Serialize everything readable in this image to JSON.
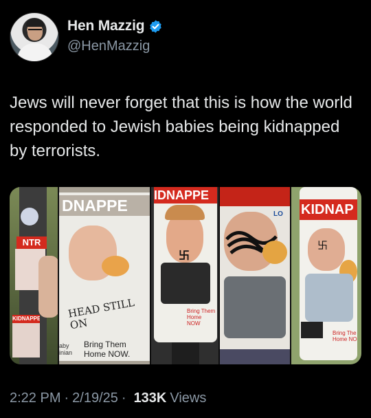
{
  "author": {
    "name": "Hen Mazzig",
    "handle": "@HenMazzig",
    "verified_icon": "verified-badge-icon",
    "accent": "#1d9bf0"
  },
  "tweet": {
    "text": "Jews will never forget that this is how the world responded to Jewish babies being kidnapped by terrorists."
  },
  "media": {
    "panels": [
      {
        "caption_a": "NTR",
        "caption_b": "KIDNAPPE"
      },
      {
        "headline": "DNAPPE",
        "scrawl": "HEAD STILL ON",
        "sub": "Bring Them Home NOW.",
        "side": "aby inian"
      },
      {
        "headline": "IDNAPPE",
        "sub": "Bring Them Home NOW"
      },
      {
        "headline": "LO",
        "sub": ""
      },
      {
        "headline": "KIDNAP",
        "sub": "Bring The Home NO"
      }
    ]
  },
  "meta": {
    "time": "2:22 PM",
    "date": "2/19/25",
    "separator": "·",
    "views_count": "133K",
    "views_label": "Views"
  }
}
